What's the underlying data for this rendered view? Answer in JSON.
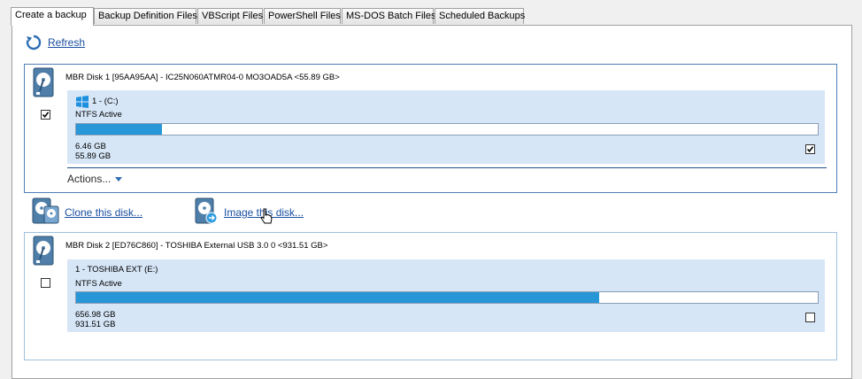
{
  "tabs": [
    {
      "label": "Create a backup",
      "active": true
    },
    {
      "label": "Backup Definition Files",
      "active": false
    },
    {
      "label": "VBScript Files",
      "active": false
    },
    {
      "label": "PowerShell Files",
      "active": false
    },
    {
      "label": "MS-DOS Batch Files",
      "active": false
    },
    {
      "label": "Scheduled Backups",
      "active": false
    }
  ],
  "toolbar": {
    "refresh_label": "Refresh"
  },
  "disks": [
    {
      "title": "MBR Disk 1 [95AA95AA] - IC25N060ATMR04-0 MO3OAD5A  <55.89 GB>",
      "checked": true,
      "partition": {
        "label": "1 - (C:)",
        "fs": "NTFS Active",
        "used": "6.46 GB",
        "total": "55.89 GB",
        "used_fraction": 0.1156,
        "checked": true
      },
      "actions_label": "Actions..."
    },
    {
      "title": "MBR Disk 2 [ED76C860] - TOSHIBA  External USB 3.0 0  <931.51 GB>",
      "checked": false,
      "partition": {
        "label": "1 - TOSHIBA EXT (E:)",
        "fs": "NTFS Active",
        "used": "656.98 GB",
        "total": "931.51 GB",
        "used_fraction": 0.7053,
        "checked": false
      }
    }
  ],
  "operations": {
    "clone_label": "Clone this disk...",
    "image_label": "Image this disk..."
  },
  "colors": {
    "accent": "#2897d7",
    "partition_bg": "#d6e6f7",
    "link": "#1a4fa0",
    "selected_border": "#4f7fb5"
  }
}
